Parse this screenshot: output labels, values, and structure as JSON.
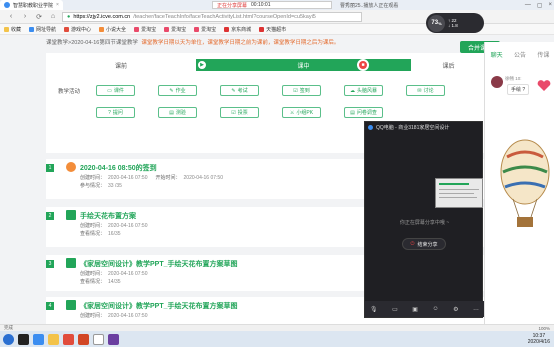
{
  "browser": {
    "tab_title": "智慧职教职业学院",
    "share_label": "正在分享屏幕",
    "share_time": "00:10:01",
    "share_status": "曹秀丽25..播放人正在观看",
    "url_host": "https://zjy2.icve.com.cn",
    "url_path": "/teacher/faceTeachInfo/faceTeachActivityList.html?courseOpenId=cu5kayi5",
    "bookmarks": [
      "收藏",
      "网址导航",
      "游戏中心",
      "小说大全",
      "爱淘宝",
      "爱淘宝",
      "爱淘宝",
      "京东商城",
      "天猫超市"
    ]
  },
  "page": {
    "breadcrumb": "课堂教学>2020-04-16第四节课堂教学",
    "hint": "课堂教学日期以天为单位，课堂教学日期之前为课前，课堂教学日期之后为课后。",
    "merge_label": "合并课堂",
    "stages": [
      "课前",
      "课中",
      "课后"
    ],
    "activities_label": "教学活动",
    "activities": [
      "课件",
      "作业",
      "考试",
      "签到",
      "头脑风暴",
      "讨论",
      "提问",
      "测验",
      "投票",
      "小组PK",
      "问卷调查"
    ]
  },
  "items": [
    {
      "num": "1",
      "title": "2020-04-16 08:50的签到",
      "created_label": "创建时间：",
      "created": "2020-04-16 07:50",
      "start_label": "开始时间：",
      "start": "2020-04-16 07:50",
      "extra_label": "参与情况：",
      "extra": "33 /35"
    },
    {
      "num": "2",
      "title": "手绘天花布置方案",
      "created_label": "创建时间：",
      "created": "2020-04-16 07:50",
      "extra_label": "查看情况：",
      "extra": "16/35"
    },
    {
      "num": "3",
      "title": "《家居空间设计》教学PPT_手绘天花布置方案草图",
      "created_label": "创建时间：",
      "created": "2020-04-16 07:50",
      "extra_label": "查看情况：",
      "extra": "14/35"
    },
    {
      "num": "4",
      "title": "《家居空间设计》教学PPT_手绘天花布置方案草图",
      "created_label": "创建时间：",
      "created": "2020-04-16 07:50"
    }
  ],
  "chat": {
    "tabs": [
      "聊天",
      "公告",
      "传课"
    ],
    "sender": "徐畅",
    "time": "10:",
    "bubble": "手绘 ?"
  },
  "qq": {
    "title": "QQ电脑 - 商业3181家居空间设计",
    "sharing_text": "你正在屏幕分享中哦 ~",
    "stop_label": "结束分享"
  },
  "timer": {
    "value": "73",
    "unit": "%",
    "row1": "↑ 22",
    "row2": "↓ 1.8"
  },
  "status": {
    "left": "完成",
    "right": "100%"
  },
  "clock": {
    "time": "10:37",
    "date": "2020/4/16"
  },
  "colors": {
    "accent": "#22a559",
    "danger": "#e44444"
  }
}
